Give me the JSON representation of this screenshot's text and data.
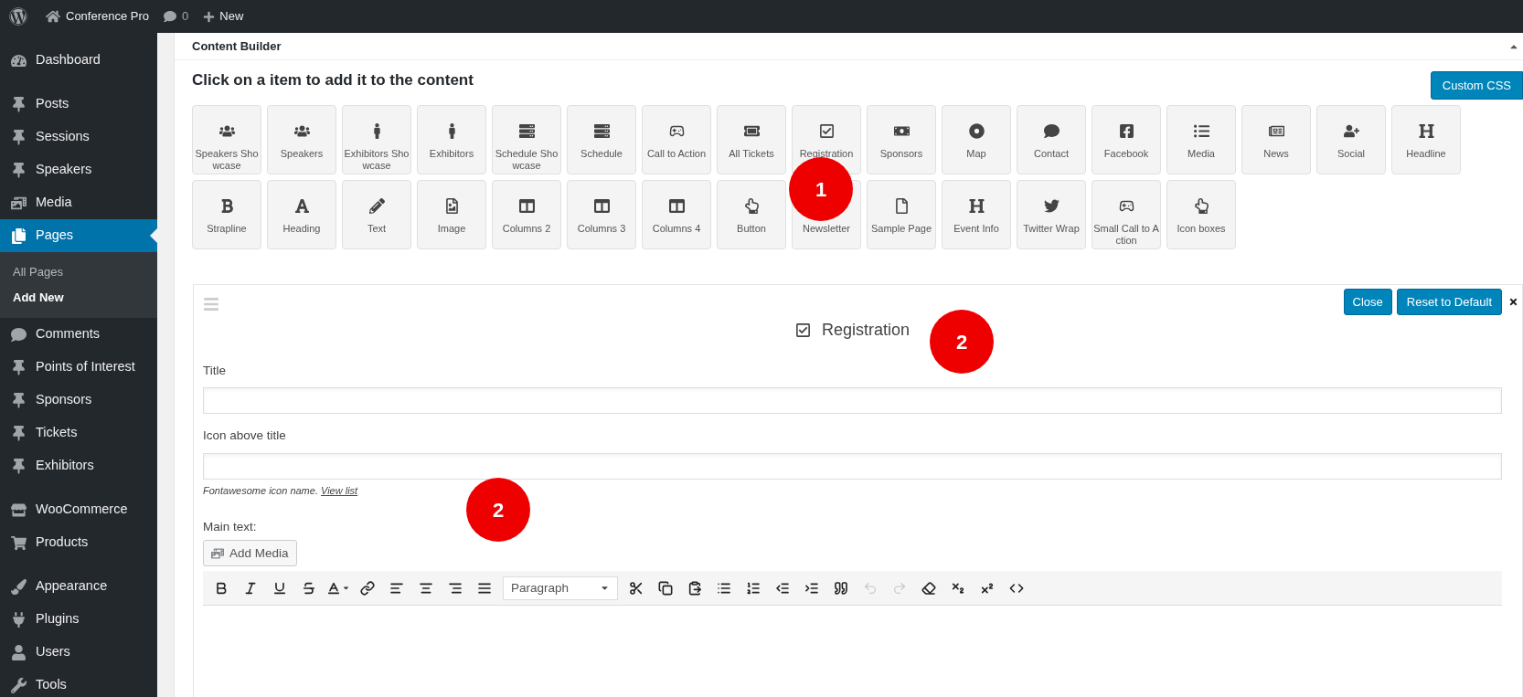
{
  "admin_bar": {
    "site_name": "Conference Pro",
    "comments_count": "0",
    "new_label": "New"
  },
  "sidebar": {
    "items": [
      {
        "label": "Dashboard",
        "selected": false
      },
      {
        "label": "Posts",
        "selected": false
      },
      {
        "label": "Sessions",
        "selected": false
      },
      {
        "label": "Speakers",
        "selected": false
      },
      {
        "label": "Media",
        "selected": false
      },
      {
        "label": "Pages",
        "selected": true,
        "children": [
          {
            "label": "All Pages",
            "selected": false
          },
          {
            "label": "Add New",
            "selected": true
          }
        ]
      },
      {
        "label": "Comments",
        "selected": false
      },
      {
        "label": "Points of Interest",
        "selected": false
      },
      {
        "label": "Sponsors",
        "selected": false
      },
      {
        "label": "Tickets",
        "selected": false
      },
      {
        "label": "Exhibitors",
        "selected": false
      },
      {
        "label": "WooCommerce",
        "selected": false
      },
      {
        "label": "Products",
        "selected": false
      },
      {
        "label": "Appearance",
        "selected": false
      },
      {
        "label": "Plugins",
        "selected": false
      },
      {
        "label": "Users",
        "selected": false
      },
      {
        "label": "Tools",
        "selected": false
      }
    ]
  },
  "content_builder": {
    "title": "Content Builder",
    "heading": "Click on a item to add it to the content",
    "custom_css_button": "Custom CSS",
    "tiles": [
      "Speakers Showcase",
      "Speakers",
      "Exhibitors Showcase",
      "Exhibitors",
      "Schedule Showcase",
      "Schedule",
      "Call to Action",
      "All Tickets",
      "Registration",
      "Sponsors",
      "Map",
      "Contact",
      "Facebook",
      "Media",
      "News",
      "Social",
      "Headline",
      "Strapline",
      "Heading",
      "Text",
      "Image",
      "Columns 2",
      "Columns 3",
      "Columns 4",
      "Button",
      "Newsletter",
      "Sample Page",
      "Event Info",
      "Twitter Wrap",
      "Small Call to Action",
      "Icon boxes"
    ]
  },
  "element_editor": {
    "title": "Registration",
    "close_button": "Close",
    "reset_button": "Reset to Default",
    "fields": [
      {
        "label": "Title"
      },
      {
        "label": "Icon above title",
        "hint": "*Fontawesome icon name.*",
        "hint_link": "View list"
      }
    ],
    "main_text_label": "Main text:",
    "add_media_button": "Add Media",
    "toolbar": {
      "format_select": "Paragraph",
      "buttons": [
        {
          "disabled": false
        },
        {
          "disabled": false
        },
        {
          "disabled": false
        },
        {
          "disabled": false
        },
        {
          "disabled": false
        },
        {
          "disabled": false
        },
        {
          "disabled": false
        },
        {
          "disabled": false
        },
        {
          "disabled": false
        },
        {
          "disabled": false
        },
        {
          "disabled": false
        },
        {
          "disabled": false
        },
        {
          "disabled": false
        },
        {
          "disabled": false
        },
        {
          "disabled": false
        },
        {
          "disabled": false
        },
        {
          "disabled": false
        },
        {
          "disabled": false
        },
        {
          "disabled": true
        },
        {
          "disabled": true
        },
        {
          "disabled": false
        },
        {
          "disabled": false
        },
        {
          "disabled": false
        },
        {
          "disabled": false
        }
      ]
    }
  },
  "annotations": [
    {
      "text": "1"
    },
    {
      "text": "2"
    },
    {
      "text": "2"
    }
  ]
}
